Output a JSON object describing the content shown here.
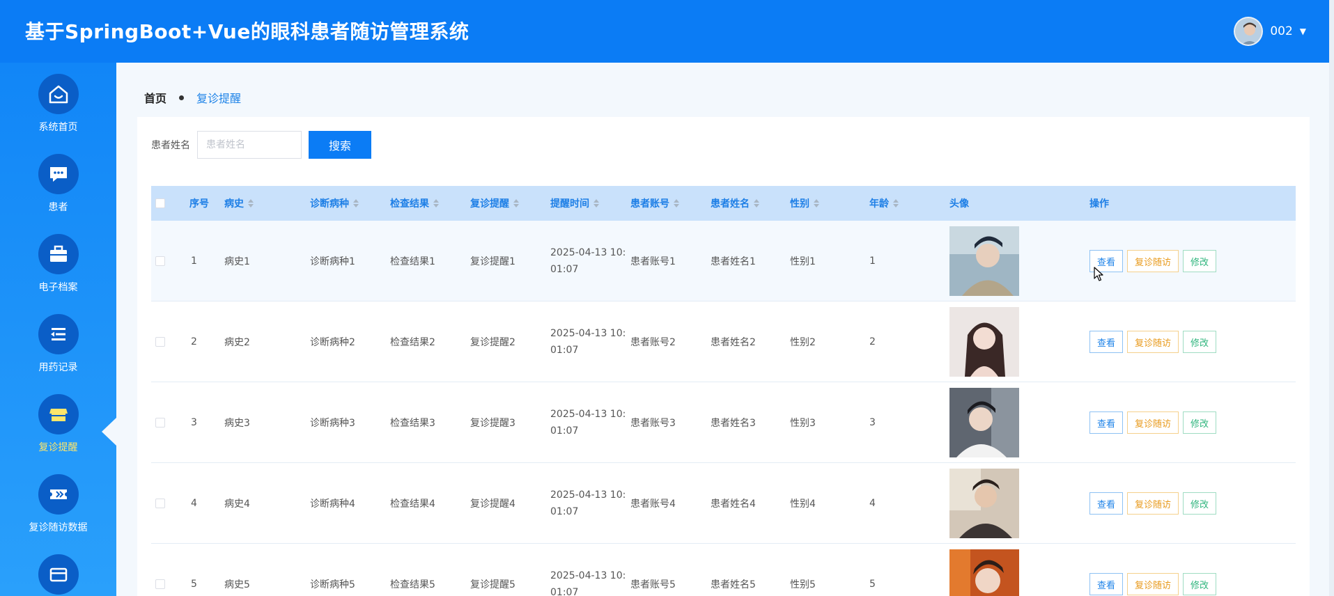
{
  "header": {
    "title": "基于SpringBoot+Vue的眼科患者随访管理系统",
    "username": "002"
  },
  "sidebar": {
    "items": [
      {
        "label": "系统首页",
        "icon": "home-icon"
      },
      {
        "label": "患者",
        "icon": "chat-icon"
      },
      {
        "label": "电子档案",
        "icon": "briefcase-icon"
      },
      {
        "label": "用药记录",
        "icon": "list-icon"
      },
      {
        "label": "复诊提醒",
        "icon": "store-icon",
        "active": true
      },
      {
        "label": "复诊随访数据",
        "icon": "ticket-icon"
      },
      {
        "label": "",
        "icon": "card-icon"
      }
    ]
  },
  "breadcrumb": {
    "home": "首页",
    "current": "复诊提醒"
  },
  "search": {
    "label": "患者姓名",
    "placeholder": "患者姓名",
    "button": "搜索"
  },
  "table": {
    "columns": [
      "序号",
      "病史",
      "诊断病种",
      "检查结果",
      "复诊提醒",
      "提醒时间",
      "患者账号",
      "患者姓名",
      "性别",
      "年龄",
      "头像",
      "操作"
    ],
    "actions": {
      "view": "查看",
      "follow": "复诊随访",
      "edit": "修改"
    },
    "rows": [
      {
        "no": "1",
        "history": "病史1",
        "diagnosis": "诊断病种1",
        "result": "检查结果1",
        "reminder": "复诊提醒1",
        "time1": "2025-04-13 10:",
        "time2": "01:07",
        "account": "患者账号1",
        "name": "患者姓名1",
        "gender": "性别1",
        "age": "1"
      },
      {
        "no": "2",
        "history": "病史2",
        "diagnosis": "诊断病种2",
        "result": "检查结果2",
        "reminder": "复诊提醒2",
        "time1": "2025-04-13 10:",
        "time2": "01:07",
        "account": "患者账号2",
        "name": "患者姓名2",
        "gender": "性别2",
        "age": "2"
      },
      {
        "no": "3",
        "history": "病史3",
        "diagnosis": "诊断病种3",
        "result": "检查结果3",
        "reminder": "复诊提醒3",
        "time1": "2025-04-13 10:",
        "time2": "01:07",
        "account": "患者账号3",
        "name": "患者姓名3",
        "gender": "性别3",
        "age": "3"
      },
      {
        "no": "4",
        "history": "病史4",
        "diagnosis": "诊断病种4",
        "result": "检查结果4",
        "reminder": "复诊提醒4",
        "time1": "2025-04-13 10:",
        "time2": "01:07",
        "account": "患者账号4",
        "name": "患者姓名4",
        "gender": "性别4",
        "age": "4"
      },
      {
        "no": "5",
        "history": "病史5",
        "diagnosis": "诊断病种5",
        "result": "检查结果5",
        "reminder": "复诊提醒5",
        "time1": "2025-04-13 10:",
        "time2": "01:07",
        "account": "患者账号5",
        "name": "患者姓名5",
        "gender": "性别5",
        "age": "5"
      }
    ]
  },
  "colors": {
    "primary": "#0b7cf5",
    "header_bg": "#0b7cf5",
    "active_nav": "#ffe66b",
    "table_head_bg": "#c9e1fb"
  }
}
